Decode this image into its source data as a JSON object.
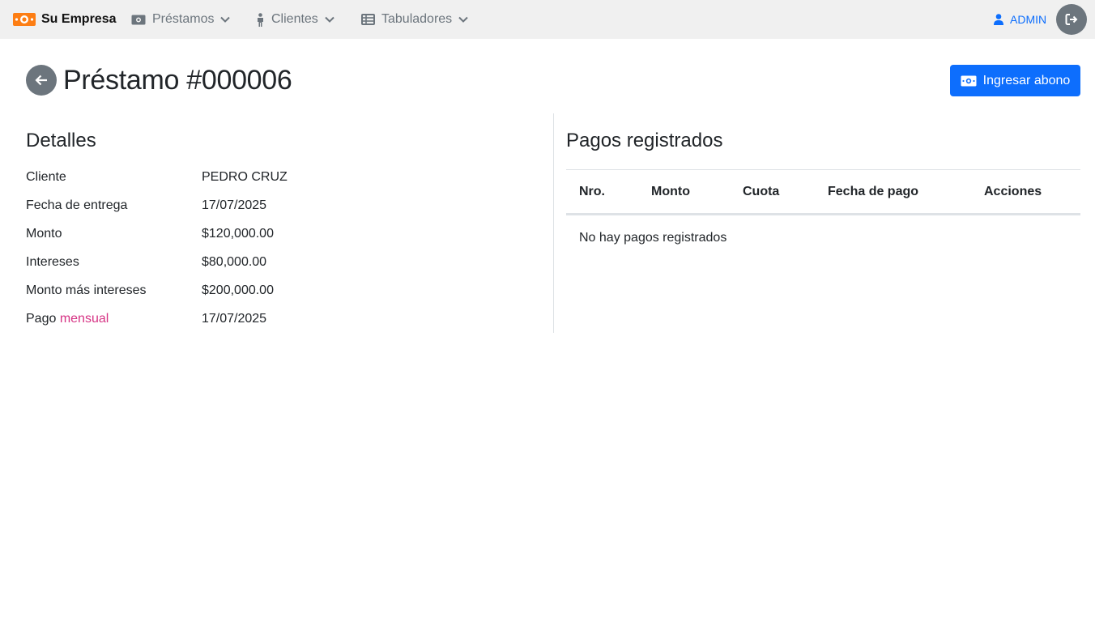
{
  "navbar": {
    "brand": "Su Empresa",
    "items": [
      {
        "label": "Préstamos",
        "icon": "money-bill-icon"
      },
      {
        "label": "Clientes",
        "icon": "person-icon"
      },
      {
        "label": "Tabuladores",
        "icon": "table-icon"
      }
    ],
    "user": "ADMIN"
  },
  "header": {
    "title": "Préstamo #000006",
    "abono_label": "Ingresar abono"
  },
  "details": {
    "title": "Detalles",
    "rows": [
      {
        "label": "Cliente",
        "value": "PEDRO CRUZ"
      },
      {
        "label": "Fecha de entrega",
        "value": "17/07/2025"
      },
      {
        "label": "Monto",
        "value": "$120,000.00"
      },
      {
        "label": "Intereses",
        "value": "$80,000.00"
      },
      {
        "label": "Monto más intereses",
        "value": "$200,000.00"
      },
      {
        "label_prefix": "Pago ",
        "label_accent": "mensual",
        "value": "17/07/2025"
      }
    ]
  },
  "payments": {
    "title": "Pagos registrados",
    "columns": [
      "Nro.",
      "Monto",
      "Cuota",
      "Fecha de pago",
      "Acciones"
    ],
    "empty_message": "No hay pagos registrados"
  },
  "colors": {
    "primary": "#0d6efd",
    "secondary": "#6c757d",
    "accent": "#d63384",
    "brand_orange": "#fd7e14",
    "navbar_bg": "#f0f0f0"
  }
}
